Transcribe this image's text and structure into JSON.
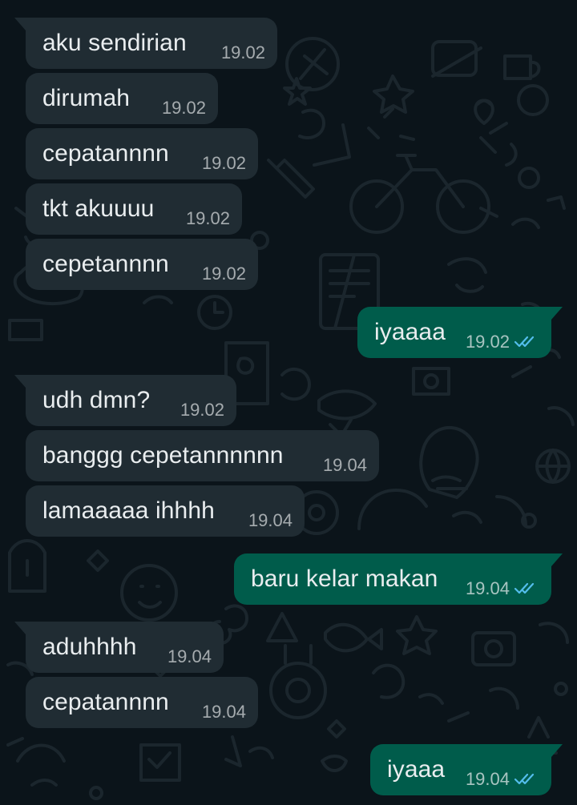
{
  "chat": {
    "messages": [
      {
        "direction": "incoming",
        "text": "aku sendirian",
        "time": "19.02"
      },
      {
        "direction": "incoming",
        "text": "dirumah",
        "time": "19.02"
      },
      {
        "direction": "incoming",
        "text": "cepatannnn",
        "time": "19.02"
      },
      {
        "direction": "incoming",
        "text": "tkt akuuuu",
        "time": "19.02"
      },
      {
        "direction": "incoming",
        "text": "cepetannnn",
        "time": "19.02"
      },
      {
        "direction": "outgoing",
        "text": "iyaaaa",
        "time": "19.02",
        "status": "read"
      },
      {
        "direction": "incoming",
        "text": "udh dmn?",
        "time": "19.02"
      },
      {
        "direction": "incoming",
        "text": "banggg cepetannnnnn",
        "time": "19.04"
      },
      {
        "direction": "incoming",
        "text": "lamaaaaa ihhhh",
        "time": "19.04"
      },
      {
        "direction": "outgoing",
        "text": "baru kelar makan",
        "time": "19.04",
        "status": "read"
      },
      {
        "direction": "incoming",
        "text": "aduhhhh",
        "time": "19.04"
      },
      {
        "direction": "incoming",
        "text": "cepatannnn",
        "time": "19.04"
      },
      {
        "direction": "outgoing",
        "text": "iyaaa",
        "time": "19.04",
        "status": "read"
      }
    ]
  },
  "colors": {
    "background": "#0b141a",
    "incoming_bubble": "#202c33",
    "outgoing_bubble": "#005c4b",
    "read_receipt": "#53bdeb",
    "text": "#e9edef"
  },
  "icons": {
    "read_receipt": "double-check-icon"
  }
}
